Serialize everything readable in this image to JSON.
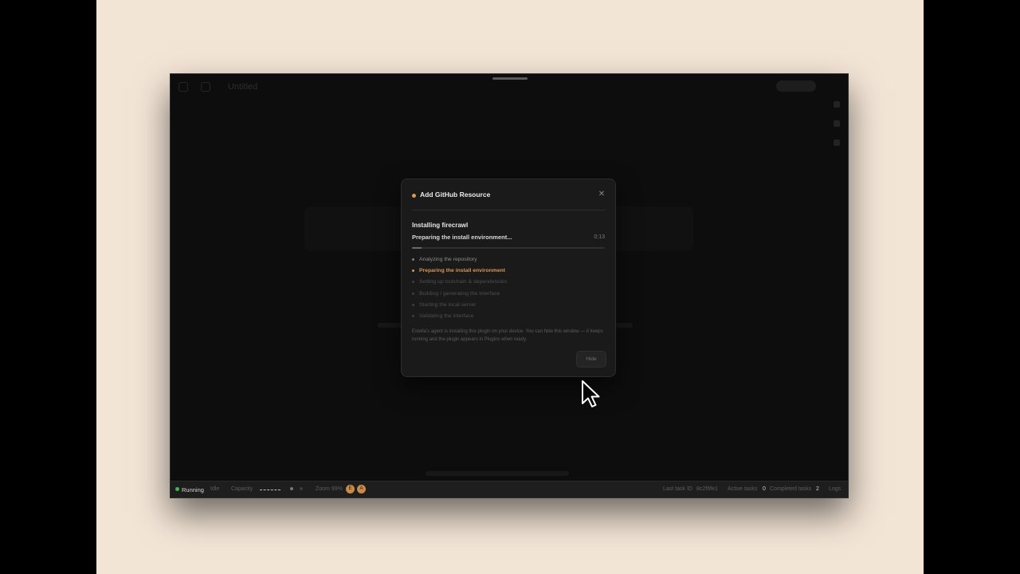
{
  "app": {
    "top_bar": {
      "title": "Untitled"
    },
    "status_bar": {
      "running": "Running",
      "idle": "Idle",
      "capacity_label": "Capacity",
      "zoom": "Zoom 99%",
      "avatars": [
        "E",
        "A"
      ],
      "last_task_label": "Last task ID",
      "last_task_id": "8c2f6fe1",
      "active_label": "Active tasks",
      "active_value": "0",
      "completed_label": "Completed tasks",
      "completed_value": "2",
      "logs": "Logs"
    }
  },
  "modal": {
    "title": "Add GitHub Resource",
    "heading": "Installing firecrawl",
    "status": "Preparing the install environment...",
    "timer": "0:13",
    "progress": 0.05,
    "steps": [
      {
        "label": "Analyzing the repository",
        "state": "done"
      },
      {
        "label": "Preparing the install environment",
        "state": "active"
      },
      {
        "label": "Setting up toolchain & dependencies",
        "state": "pending"
      },
      {
        "label": "Building / generating the interface",
        "state": "pending"
      },
      {
        "label": "Starting the local server",
        "state": "pending"
      },
      {
        "label": "Validating the interface",
        "state": "pending"
      }
    ],
    "note": "Estella's agent is installing this plugin on your device. You can hide this window — it keeps running and the plugin appears in Plugins when ready.",
    "hide_label": "Hide"
  },
  "colors": {
    "accent": "#d9955a",
    "running": "#3fb950",
    "background": "#f3e5d6"
  }
}
